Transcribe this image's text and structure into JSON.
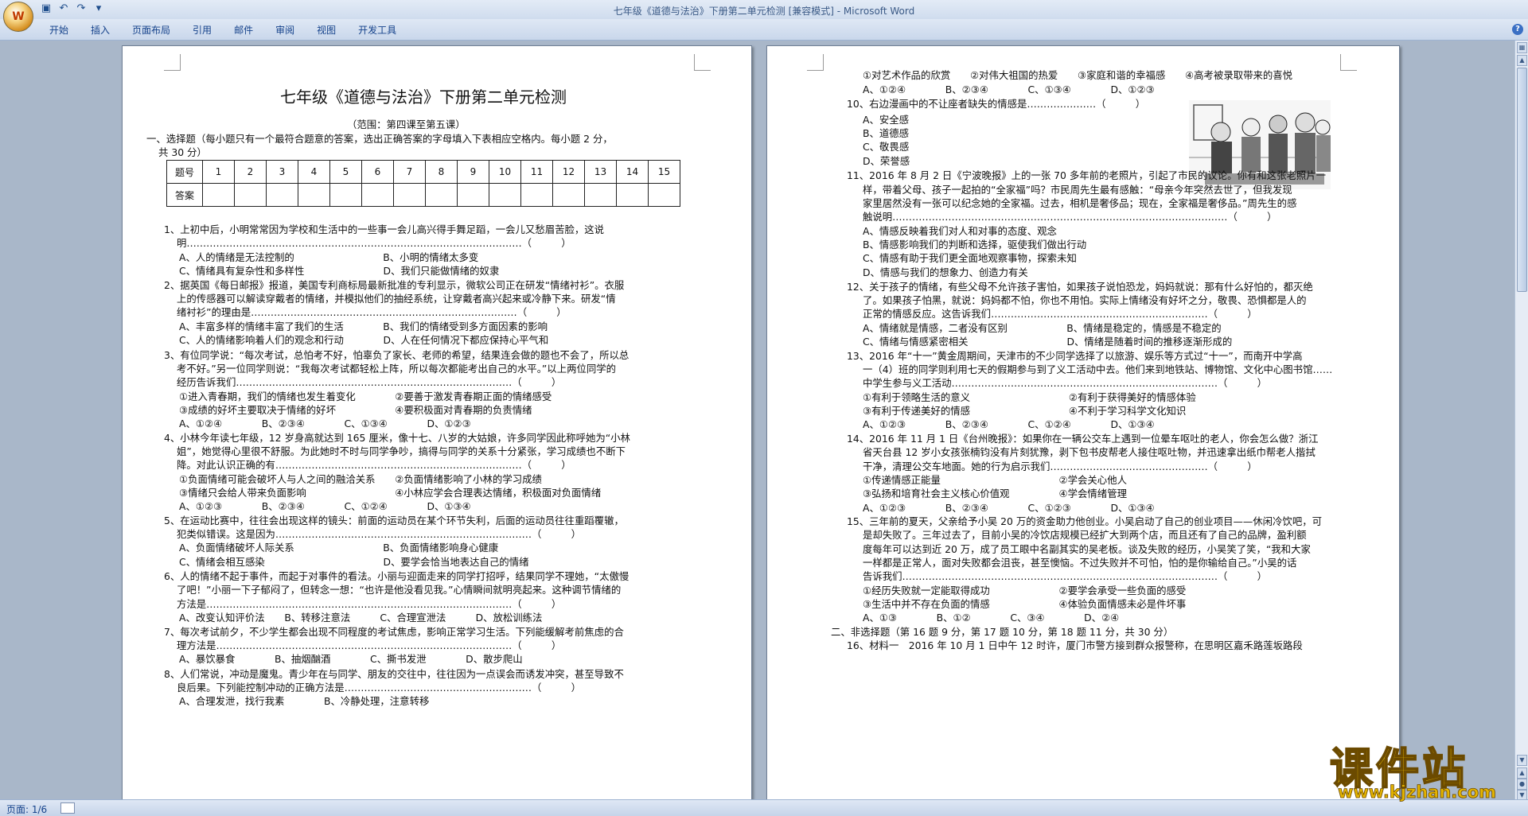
{
  "window": {
    "title": "七年级《道德与法治》下册第二单元检测 [兼容模式] - Microsoft Word",
    "office_button": "W"
  },
  "quick_access": [
    "save-icon",
    "undo-icon",
    "redo-icon",
    "customize-icon"
  ],
  "ribbon": {
    "tabs": [
      "开始",
      "插入",
      "页面布局",
      "引用",
      "邮件",
      "审阅",
      "视图",
      "开发工具"
    ]
  },
  "status": {
    "page": "页面: 1/6"
  },
  "watermark": {
    "title": "课件站",
    "url": "www.kjzhan.com"
  },
  "page1": {
    "title": "七年级《道德与法治》下册第二单元检测",
    "lines": [
      "（范围：第四课至第五课）",
      "一、选择题（每小题只有一个最符合题意的答案，选出正确答案的字母填入下表相应空格内。每小题 2 分，",
      "共 30 分）",
      "1、上初中后，小明常常因为学校和生活中的一些事一会儿高兴得手舞足蹈，一会儿又愁眉苦脸，这说",
      "明…………………………………………………………………………………………（　　　）",
      "A、人的情绪是无法控制的　　　　　　　　　B、小明的情绪太多变",
      "C、情绪具有复杂性和多样性　　　　　　　　D、我们只能做情绪的奴隶",
      "2、据英国《每日邮报》报道，美国专利商标局最新批准的专利显示，微软公司正在研发“情绪衬衫”。衣服",
      "上的传感器可以解读穿戴者的情绪，并模拟他们的抽经系统，让穿戴者高兴起来或冷静下来。研发“情",
      "绪衬衫”的理由是………………………………………………………………………（　　　）",
      "A、丰富多样的情绪丰富了我们的生活　　　　B、我们的情绪受到多方面因素的影响",
      "C、人的情绪影响着人们的观念和行动　　　　D、人在任何情况下都应保持心平气和",
      "3、有位同学说：“每次考试，总怕考不好，怕辜负了家长、老师的希望，结果连会做的题也不会了，所以总",
      "考不好。”另一位同学则说：“我每次考试都轻松上阵，所以每次都能考出自己的水平。”以上两位同学的",
      "经历告诉我们…………………………………………………………………………（　　　）",
      "①进入青春期，我们的情绪也发生着变化　　　　②要善于激发青春期正面的情绪感受",
      "③成绩的好坏主要取决于情绪的好坏　　　　　　④要积极面对青春期的负责情绪",
      "A、①②④　　　　B、②③④　　　　C、①③④　　　　D、①②③",
      "4、小林今年读七年级，12 岁身高就达到 165 厘米，像十七、八岁的大姑娘，许多同学因此称呼她为“小林",
      "姐”，她觉得心里很不舒服。为此她时不时与同学争吵，搞得与同学的关系十分紧张，学习成绩也不断下",
      "降。对此认识正确的有…………………………………………………………………（　　　）",
      "①负面情绪可能会破坏人与人之间的融洽关系　　②负面情绪影响了小林的学习成绩",
      "③情绪只会给人带来负面影响　　　　　　　　　④小林应学会合理表达情绪，积极面对负面情绪",
      "A、①②③　　　　B、②③④　　　　C、①②④　　　　D、①③④",
      "5、在运动比赛中，往往会出现这样的镜头：前面的运动员在某个环节失利，后面的运动员往往重蹈覆辙，",
      "犯类似错误。这是因为……………………………………………………………………（　　　）",
      "A、负面情绪破坏人际关系　　　　　　　　　B、负面情绪影响身心健康",
      "C、情绪会相互感染　　　　　　　　　　　　D、要学会恰当地表达自己的情绪",
      "6、人的情绪不起于事件，而起于对事件的看法。小丽与迎面走来的同学打招呼，结果同学不理她，“太傲慢",
      "了吧！”小丽一下子郁闷了，但转念一想：“也许是他没看见我。”心情瞬间就明亮起来。这种调节情绪的",
      "方法是…………………………………………………………………………………（　　　）",
      "A、改变认知评价法　　B、转移注意法　　　C、合理宣泄法　　　D、放松训练法",
      "7、每次考试前夕，不少学生都会出现不同程度的考试焦虑，影响正常学习生活。下列能缓解考前焦虑的合",
      "理方法是………………………………………………………………………………（　　　）",
      "A、暴饮暴食　　　　B、抽烟酗酒　　　　C、撕书发泄　　　　D、散步爬山",
      "8、人们常说，冲动是魔鬼。青少年在与同学、朋友的交往中，往往因为一点误会而诱发冲突，甚至导致不",
      "良后果。下列能控制冲动的正确方法是…………………………………………………（　　　）",
      "A、合理发泄，找行我素　　　　B、冷静处理，注意转移"
    ],
    "answer_table": {
      "row_labels": [
        "题号",
        "答案"
      ],
      "numbers": [
        "1",
        "2",
        "3",
        "4",
        "5",
        "6",
        "7",
        "8",
        "9",
        "10",
        "11",
        "12",
        "13",
        "14",
        "15"
      ]
    }
  },
  "page2": {
    "lines": [
      "①对艺术作品的欣赏　　②对伟大祖国的热爱　　③家庭和谐的幸福感　　④高考被录取带来的喜悦",
      "A、①②④　　　　B、②③④　　　　C、①③④　　　　D、①②③",
      "10、右边漫画中的不让座者缺失的情感是…………………（　　　）",
      "A、安全感",
      "B、道德感",
      "C、敬畏感",
      "D、荣誉感",
      "11、2016 年 8 月 2 日《宁波晚报》上的一张 70 多年前的老照片，引起了市民的议论。你有和这张老照片一",
      "样，带着父母、孩子一起拍的“全家福”吗？市民周先生最有感触：“母亲今年突然去世了，但我发现",
      "家里居然没有一张可以纪念她的全家福。过去，相机是奢侈品；现在，全家福是奢侈品。”周先生的感",
      "触说明…………………………………………………………………………………………（　　　）",
      "A、情感反映着我们对人和对事的态度、观念",
      "B、情感影响我们的判断和选择，驱使我们做出行动",
      "C、情感有助于我们更全面地观察事物，探索未知",
      "D、情感与我们的想象力、创造力有关",
      "12、关于孩子的情绪，有些父母不允许孩子害怕，如果孩子说怕恐龙，妈妈就说：那有什么好怕的，都灭绝",
      "了。如果孩子怕黑，就说：妈妈都不怕，你也不用怕。实际上情绪没有好坏之分，敬畏、恐惧都是人的",
      "正常的情感反应。这告诉我们…………………………………………………………（　　　）",
      "A、情绪就是情感，二者没有区别　　　　　　B、情绪是稳定的，情感是不稳定的",
      "C、情绪与情感紧密相关　　　　　　　　　　D、情绪是随着时间的推移逐渐形成的",
      "13、2016 年“十一”黄金周期间，天津市的不少同学选择了以旅游、娱乐等方式过“十一”，而南开中学高",
      "一（4）班的同学则利用七天的假期参与到了义工活动中去。他们来到地铁站、博物馆、文化中心图书馆……",
      "中学生参与义工活动………………………………………………………………………（　　　）",
      "①有利于领略生活的意义　　　　　　　　　　②有利于获得美好的情感体验",
      "③有利于传递美好的情感　　　　　　　　　　④不利于学习科学文化知识",
      "A、①②③　　　　B、②③④　　　　C、①②④　　　　D、①③④",
      "14、2016 年 11 月 1 日《台州晚报》：如果你在一辆公交车上遇到一位晕车呕吐的老人，你会怎么做？浙江",
      "省天台县 12 岁小女孩张楠钧没有片刻犹豫，剥下包书皮帮老人接住呕吐物，并迅速拿出纸巾帮老人揩拭",
      "干净，清理公交车地面。她的行为启示我们…………………………………………（　　　）",
      "①传递情感正能量　　　　　　　　　　　　②学会关心他人",
      "③弘扬和培育社会主义核心价值观　　　　　④学会情绪管理",
      "A、①②③　　　　B、②③④　　　　C、①②③　　　　D、①③④",
      "15、三年前的夏天，父亲给予小吴 20 万的资金助力他创业。小吴启动了自己的创业项目——休闲冷饮吧，可",
      "是却失败了。三年过去了，目前小吴的冷饮店规模已经扩大到两个店，而且还有了自己的品牌，盈利额",
      "度每年可以达到近 20 万，成了员工眼中名副其实的吴老板。谈及失败的经历，小吴笑了笑，“我和大家",
      "一样都是正常人，面对失败都会沮丧，甚至懊恼。不过失败并不可怕，怕的是你输给自己。”小吴的话",
      "告诉我们……………………………………………………………………………………（　　　）",
      "①经历失败就一定能取得成功　　　　　　　②要学会承受一些负面的感受",
      "③生活中并不存在负面的情感　　　　　　　④体验负面情感未必是件坏事",
      "A、①③　　　　B、①②　　　　C、③④　　　　D、②④",
      "二、非选择题（第 16 题 9 分，第 17 题 10 分，第 18 题 11 分，共 30 分）",
      "16、材料一　2016 年 10 月 1 日中午 12 时许，厦门市警方接到群众报警称，在思明区嘉禾路莲坂路段"
    ]
  }
}
